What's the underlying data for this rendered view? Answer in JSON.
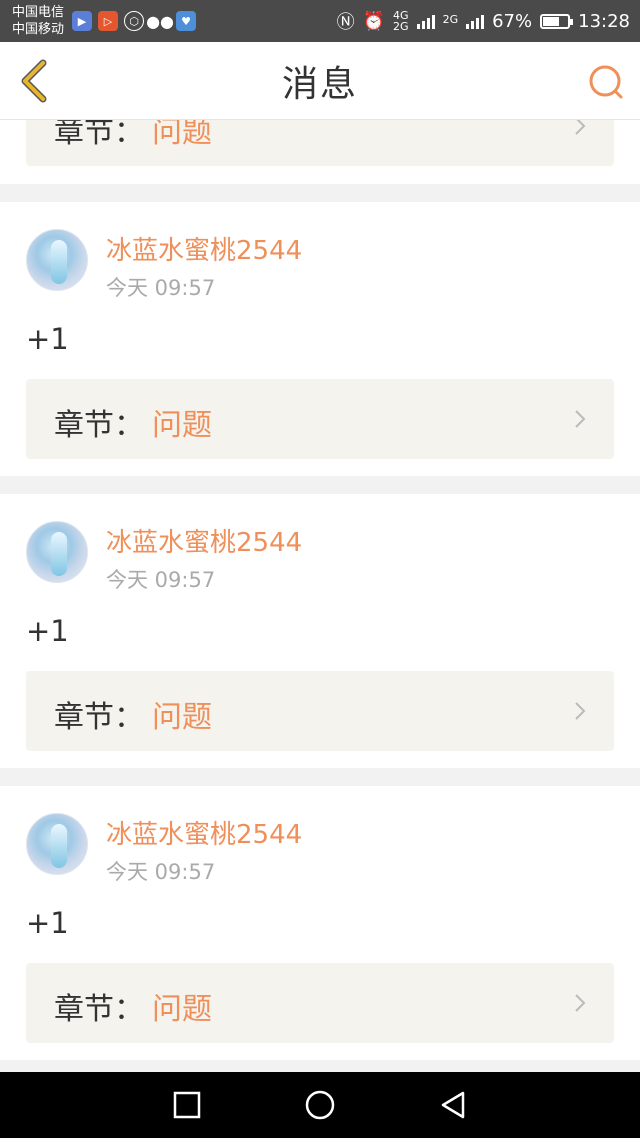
{
  "status_bar": {
    "carrier_1": "中国电信",
    "carrier_2": "中国移动",
    "network_1": "4G",
    "network_2": "2G",
    "network_3": "2G",
    "battery_percent": "67%",
    "battery_level": 0.67,
    "time": "13:28",
    "app_icons": [
      "video-app-icon",
      "play-app-icon",
      "settings-app-icon",
      "wechat-icon",
      "heart-app-icon"
    ]
  },
  "header": {
    "title": "消息",
    "back_icon": "chevron-left-icon",
    "search_icon": "search-icon"
  },
  "partial_card": {
    "chapter_label": "章节：",
    "chapter_value": "问题"
  },
  "messages": [
    {
      "username": "冰蓝水蜜桃2544",
      "time": "今天 09:57",
      "content": "+1",
      "chapter_label": "章节：",
      "chapter_value": "问题"
    },
    {
      "username": "冰蓝水蜜桃2544",
      "time": "今天 09:57",
      "content": "+1",
      "chapter_label": "章节：",
      "chapter_value": "问题"
    },
    {
      "username": "冰蓝水蜜桃2544",
      "time": "今天 09:57",
      "content": "+1",
      "chapter_label": "章节：",
      "chapter_value": "问题"
    }
  ],
  "colors": {
    "accent": "#ef8f5a",
    "back_arrow": "#e8b62c",
    "card_bg": "#ffffff",
    "chapter_bg": "#f4f3ee",
    "page_bg": "#f2f2f2"
  }
}
